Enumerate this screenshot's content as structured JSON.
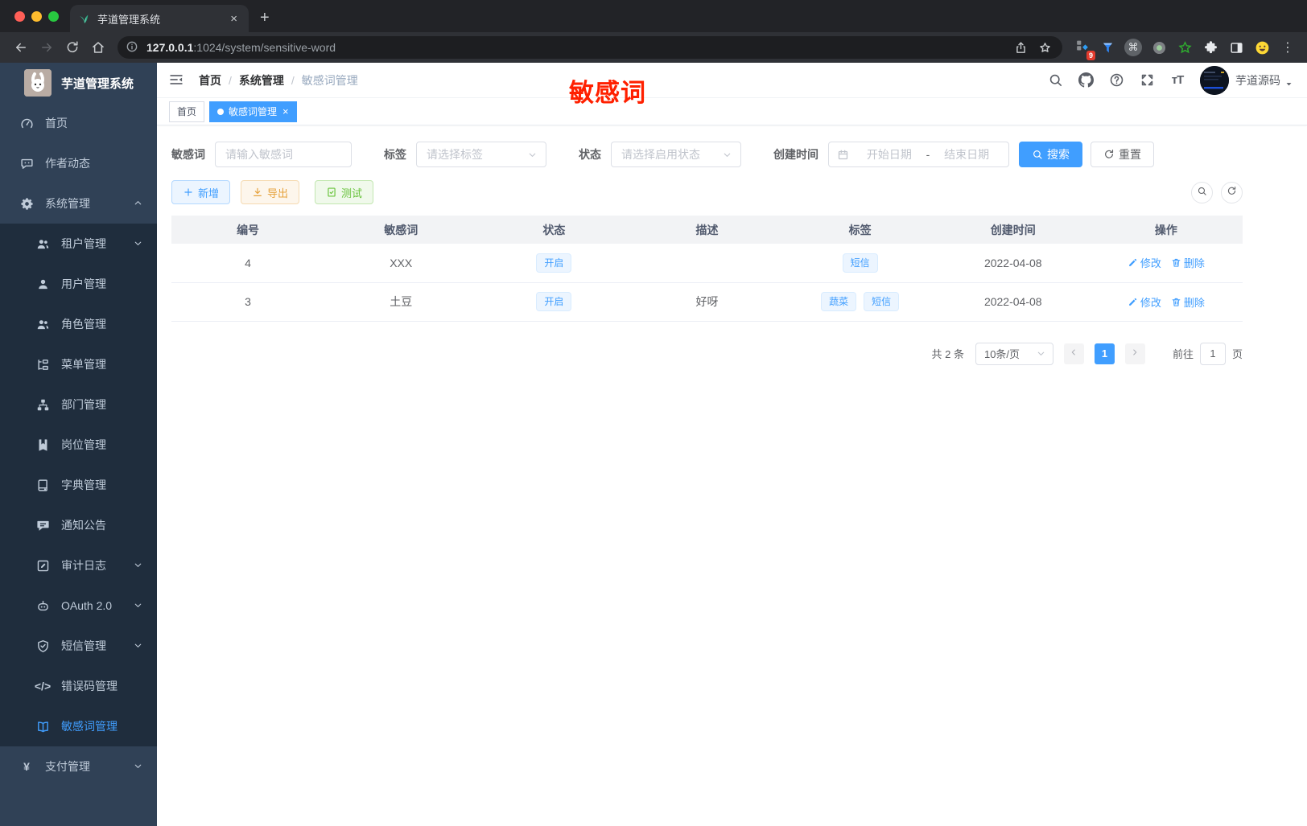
{
  "browser": {
    "tab_title": "芋道管理系统",
    "url_host": "127.0.0.1",
    "url_path": ":1024/system/sensitive-word",
    "extensions_badge": "9",
    "new_tab_label": "+",
    "tab_close_label": "×"
  },
  "sidebar": {
    "title": "芋道管理系统",
    "items": [
      {
        "label": "首页",
        "icon": "gauge-icon",
        "level": 1
      },
      {
        "label": "作者动态",
        "icon": "chat-icon",
        "level": 1
      },
      {
        "label": "系统管理",
        "icon": "gear-icon",
        "level": 1,
        "caret": "up"
      },
      {
        "label": "租户管理",
        "icon": "tenant-icon",
        "level": 2,
        "caret": "down"
      },
      {
        "label": "用户管理",
        "icon": "user-icon",
        "level": 2
      },
      {
        "label": "角色管理",
        "icon": "role-icon",
        "level": 2
      },
      {
        "label": "菜单管理",
        "icon": "menu-tree-icon",
        "level": 2
      },
      {
        "label": "部门管理",
        "icon": "dept-icon",
        "level": 2
      },
      {
        "label": "岗位管理",
        "icon": "post-icon",
        "level": 2
      },
      {
        "label": "字典管理",
        "icon": "dict-icon",
        "level": 2
      },
      {
        "label": "通知公告",
        "icon": "notice-icon",
        "level": 2
      },
      {
        "label": "审计日志",
        "icon": "audit-icon",
        "level": 2,
        "caret": "down"
      },
      {
        "label": "OAuth 2.0",
        "icon": "oauth-icon",
        "level": 2,
        "caret": "down"
      },
      {
        "label": "短信管理",
        "icon": "shield-icon",
        "level": 2,
        "caret": "down"
      },
      {
        "label": "错误码管理",
        "icon": "code-icon",
        "level": 2
      },
      {
        "label": "敏感词管理",
        "icon": "open-book-icon",
        "level": 2,
        "active": true
      },
      {
        "label": "支付管理",
        "icon": "yen-icon",
        "level": 1,
        "caret": "down"
      }
    ]
  },
  "header": {
    "breadcrumb": [
      "首页",
      "系统管理",
      "敏感词管理"
    ],
    "annotation": "敏感词",
    "username": "芋道源码"
  },
  "tags_view": {
    "tabs": [
      {
        "label": "首页",
        "active": false
      },
      {
        "label": "敏感词管理",
        "active": true,
        "dot": true,
        "closable": true
      }
    ]
  },
  "filters": {
    "keyword_label": "敏感词",
    "keyword_placeholder": "请输入敏感词",
    "tag_label": "标签",
    "tag_placeholder": "请选择标签",
    "status_label": "状态",
    "status_placeholder": "请选择启用状态",
    "date_label": "创建时间",
    "date_start_placeholder": "开始日期",
    "date_separator": "-",
    "date_end_placeholder": "结束日期",
    "search_button": "搜索",
    "reset_button": "重置"
  },
  "toolbar": {
    "add_label": "新增",
    "export_label": "导出",
    "test_label": "测试"
  },
  "table": {
    "columns": [
      "编号",
      "敏感词",
      "状态",
      "描述",
      "标签",
      "创建时间",
      "操作"
    ],
    "rows": [
      {
        "id": "4",
        "word": "XXX",
        "status": "开启",
        "description": "",
        "tags": [
          "短信"
        ],
        "created": "2022-04-08",
        "edit_label": "修改",
        "delete_label": "删除"
      },
      {
        "id": "3",
        "word": "土豆",
        "status": "开启",
        "description": "好呀",
        "tags": [
          "蔬菜",
          "短信"
        ],
        "created": "2022-04-08",
        "edit_label": "修改",
        "delete_label": "删除"
      }
    ]
  },
  "pagination": {
    "total": "共 2 条",
    "page_size": "10条/页",
    "active_page": "1",
    "goto_label": "前往",
    "goto_value": "1",
    "unit_label": "页"
  },
  "colors": {
    "primary": "#409eff",
    "warning": "#e6a23c",
    "success": "#67c23a",
    "annotation_red": "#ff2000",
    "sidebar_bg": "#304156",
    "submenu_bg": "#1f2d3d",
    "table_header_bg": "#f2f3f5"
  }
}
